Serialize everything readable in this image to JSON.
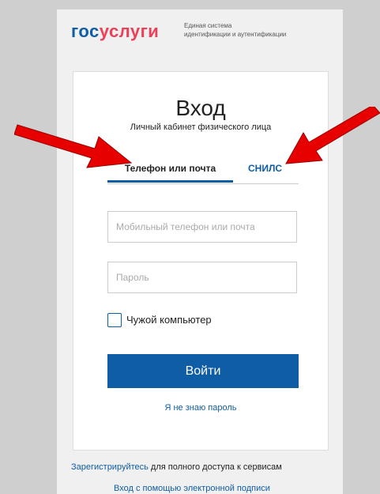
{
  "header": {
    "logo_gos": "гос",
    "logo_uslugi": "услуги",
    "subtitle_line1": "Единая система",
    "subtitle_line2": "идентификации и аутентификации"
  },
  "card": {
    "title": "Вход",
    "subtitle": "Личный кабинет физического лица",
    "tabs": [
      {
        "label": "Телефон или почта",
        "active": true
      },
      {
        "label": "СНИЛС",
        "active": false
      }
    ],
    "login_placeholder": "Мобильный телефон или почта",
    "password_placeholder": "Пароль",
    "checkbox_label": "Чужой компьютер",
    "submit_label": "Войти",
    "forgot_label": "Я не знаю пароль"
  },
  "footer": {
    "register_link": "Зарегистрируйтесь",
    "register_text": " для полного доступа к сервисам",
    "esign_link": "Вход с помощью электронной подписи"
  },
  "colors": {
    "brand_blue": "#0f5da5",
    "brand_red": "#ee3f58",
    "arrow_red": "#e60000"
  },
  "icons": [
    "arrow-pointer-icon"
  ]
}
